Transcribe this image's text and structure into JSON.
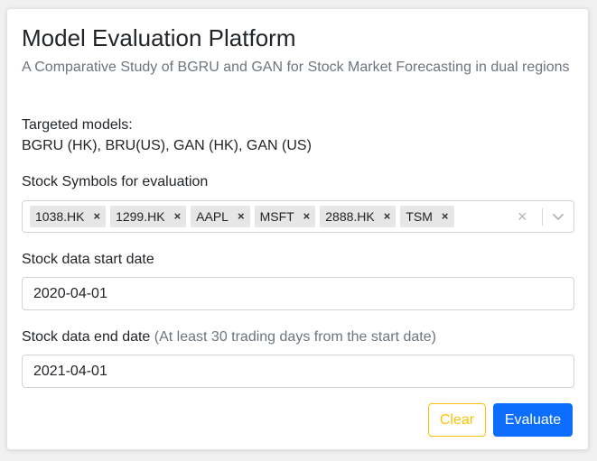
{
  "header": {
    "title": "Model Evaluation Platform",
    "subtitle": "A Comparative Study of BGRU and GAN for Stock Market Forecasting in dual regions"
  },
  "models": {
    "label": "Targeted models:",
    "value": "BGRU (HK), BRU(US), GAN (HK), GAN (US)"
  },
  "symbols": {
    "label": "Stock Symbols for evaluation",
    "selected": [
      "1038.HK",
      "1299.HK",
      "AAPL",
      "MSFT",
      "2888.HK",
      "TSM"
    ],
    "remove_glyph": "×",
    "clear_glyph": "×"
  },
  "start_date": {
    "label": "Stock data start date",
    "value": "2020-04-01"
  },
  "end_date": {
    "label": "Stock data end date",
    "hint": "(At least 30 trading days from the start date)",
    "value": "2021-04-01"
  },
  "actions": {
    "clear_label": "Clear",
    "evaluate_label": "Evaluate"
  },
  "colors": {
    "primary": "#0d6efd",
    "warning": "#ffc107",
    "muted": "#6c757d"
  }
}
